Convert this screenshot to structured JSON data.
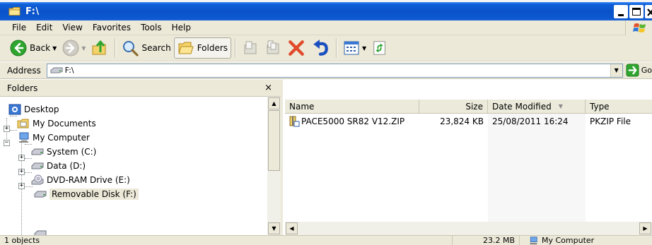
{
  "window": {
    "title": "F:\\"
  },
  "menu": [
    {
      "label": "File"
    },
    {
      "label": "Edit"
    },
    {
      "label": "View"
    },
    {
      "label": "Favorites"
    },
    {
      "label": "Tools"
    },
    {
      "label": "Help"
    }
  ],
  "toolbar": {
    "back_label": "Back",
    "search_label": "Search",
    "folders_label": "Folders"
  },
  "address": {
    "label": "Address",
    "value": "F:\\",
    "go_label": "Go"
  },
  "folders": {
    "title": "Folders",
    "close_glyph": "×",
    "items": [
      {
        "label": "Desktop"
      },
      {
        "label": "My Documents"
      },
      {
        "label": "My Computer"
      },
      {
        "label": "System (C:)"
      },
      {
        "label": "Data (D:)"
      },
      {
        "label": "DVD-RAM Drive (E:)"
      },
      {
        "label": "Removable Disk (F:)"
      }
    ]
  },
  "file_list": {
    "columns": {
      "name": "Name",
      "size": "Size",
      "modified": "Date Modified",
      "type": "Type"
    },
    "rows": [
      {
        "name": "PACE5000 SR82 V12.ZIP",
        "size": "23,824 KB",
        "modified": "25/08/2011 16:24",
        "type": "PKZIP File"
      }
    ]
  },
  "status": {
    "objects": "1 objects",
    "size": "23.2 MB",
    "zone": "My Computer"
  },
  "colors": {
    "titlebar": "#0a52c8",
    "chrome": "#ece9d8",
    "close_red": "#e04a2a",
    "go_green": "#2fa52f"
  }
}
